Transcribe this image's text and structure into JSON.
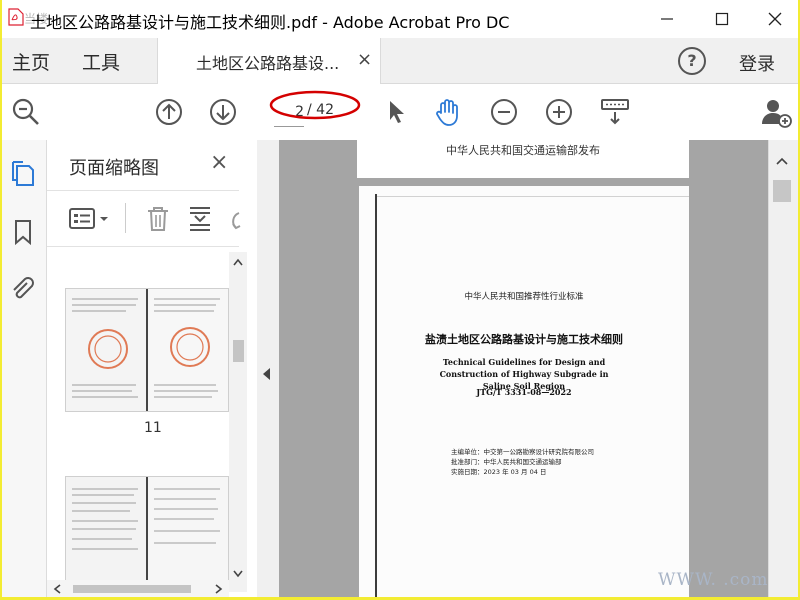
{
  "window": {
    "title": "土地区公路路基设计与施工技术细则.pdf - Adobe Acrobat Pro DC",
    "corner_watermark": "当楼"
  },
  "nav": {
    "home": "主页",
    "tools": "工具",
    "login": "登录",
    "help": "?"
  },
  "tab": {
    "label": "土地区公路路基设...",
    "close": "×"
  },
  "toolbar": {
    "current_page": "2",
    "total_pages": "/ 42"
  },
  "thumbnail_panel": {
    "title": "页面缩略图",
    "close": "×",
    "thumbnails": [
      {
        "label": "11"
      },
      {
        "label": ""
      }
    ]
  },
  "document": {
    "prev_page_footer": "中华人民共和国交通运输部发布",
    "cover": {
      "category": "中华人民共和国推荐性行业标准",
      "title_cn": "盐渍土地区公路路基设计与施工技术细则",
      "title_en": "Technical Guidelines for Design and Construction of Highway Subgrade in Saline Soil Region",
      "code": "JTG/T 3331-08—2022",
      "meta": [
        "主编单位：中交第一公路勘察设计研究院有限公司",
        "批准部门：中华人民共和国交通运输部",
        "实施日期：2023 年 03 月 04 日"
      ]
    }
  },
  "watermark": "WWW.    .com",
  "colors": {
    "accent": "#2d7ad6",
    "annotation_red": "#d40000",
    "frame": "#f3ec33"
  }
}
